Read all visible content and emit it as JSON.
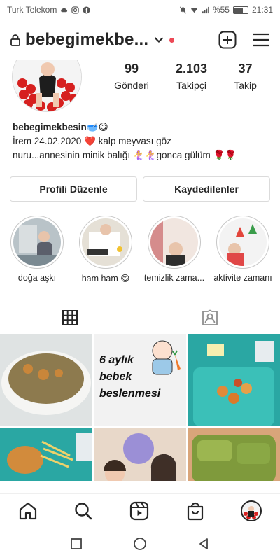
{
  "status_bar": {
    "carrier": "Turk Telekom",
    "battery": "%55",
    "time": "21:31"
  },
  "header": {
    "username": "bebegimekbe...",
    "icons": [
      "lock-icon",
      "chevron-down-icon",
      "new-post-icon",
      "menu-icon"
    ]
  },
  "profile": {
    "stats": [
      {
        "value": "99",
        "label": "Gönderi"
      },
      {
        "value": "2.103",
        "label": "Takipçi"
      },
      {
        "value": "37",
        "label": "Takip"
      }
    ],
    "bio_name": "bebegimekbesin🥣😋",
    "bio_line1": "İrem 24.02.2020 ❤️ kalp meyvası göz",
    "bio_line2": "nuru...annesinin minik balığı 🧜‍♀️🧜‍♀️gonca gülüm 🌹🌹"
  },
  "buttons": {
    "edit_profile": "Profili Düzenle",
    "saved": "Kaydedilenler"
  },
  "highlights": [
    {
      "label": "doğa aşkı",
      "color": "#8c9aa3"
    },
    {
      "label": "ham ham 😋",
      "color": "#c9c2b6"
    },
    {
      "label": "temizlik zama...",
      "color": "#d7b8a8"
    },
    {
      "label": "aktivite zamanı",
      "color": "#e9e9e9"
    }
  ],
  "tabs": [
    {
      "name": "grid",
      "icon": "grid-icon"
    },
    {
      "name": "tagged",
      "icon": "tagged-icon"
    }
  ],
  "posts": {
    "promo_lines": [
      "6 aylık",
      "bebek",
      "beslenmesi"
    ]
  },
  "bottom_nav": {
    "icons": [
      "home-icon",
      "search-icon",
      "reels-icon",
      "shop-icon",
      "profile-avatar"
    ]
  },
  "colors": {
    "accent_red": "#ed4956",
    "border": "#dbdbdb",
    "text": "#262626"
  }
}
